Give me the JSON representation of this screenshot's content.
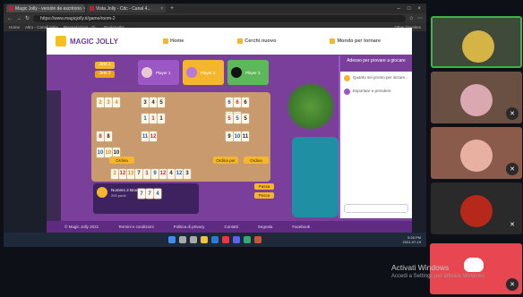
{
  "browser": {
    "tabs": [
      {
        "label": "Magic Jolly - versión de escritorio"
      },
      {
        "label": "Vista Jolly - Cdc - Canal 4..."
      }
    ],
    "new_tab": "+",
    "url": "https://www.magicjolly.it/game/room-2",
    "bookmarks": [
      "Home",
      "Altro - Canali Italia",
      "Presentazioni - Gi...",
      "Bookmarks"
    ],
    "bookmarks_right": "Other favorites"
  },
  "site": {
    "logo": "MAGIC JOLLY",
    "nav": [
      "Home",
      "Cerchi nuovo",
      "Mondo per tornare"
    ],
    "player_tab_1": "Jeni 1",
    "player_tab_2": "Jeni 2",
    "opponents": [
      {
        "name": "Player 1",
        "sub": "200 pts"
      },
      {
        "name": "Player 2",
        "sub": ""
      },
      {
        "name": "Player 3",
        "sub": "200 pts"
      }
    ],
    "buttons": {
      "ordina": "Ordina",
      "ordina2": "Ordina per",
      "b1": "Ordina",
      "b2": "Passa",
      "b3": "Pesca"
    },
    "bottom_player": {
      "name": "Numero 2 Brodi",
      "sub": "200 punti"
    },
    "chat": {
      "title": "Adesso per provare a giocare",
      "messages": [
        "Quanto sei pronto per inizare...",
        "Esportare e prendere"
      ]
    },
    "footer": [
      "© Magic Jolly 2021",
      "Termini e condizioni",
      "Politica di privacy",
      "Contatti",
      "Segnala",
      "Facebook"
    ]
  },
  "board_sets": [
    {
      "tiles": [
        {
          "v": "2",
          "c": "orange"
        },
        {
          "v": "3",
          "c": "orange"
        },
        {
          "v": "4",
          "c": "orange"
        }
      ]
    },
    {
      "tiles": [
        {
          "v": "3",
          "c": "black"
        },
        {
          "v": "4",
          "c": "black"
        },
        {
          "v": "5",
          "c": "black"
        }
      ]
    },
    {
      "tiles": [
        {
          "v": "6",
          "c": "blue"
        },
        {
          "v": "6",
          "c": "red"
        },
        {
          "v": "6",
          "c": "black"
        }
      ]
    },
    {
      "tiles": [
        {
          "v": "5",
          "c": "red"
        },
        {
          "v": "5",
          "c": "red"
        }
      ]
    },
    {
      "tiles": [
        {
          "v": "1",
          "c": "blue"
        },
        {
          "v": "1",
          "c": "red"
        },
        {
          "v": "1",
          "c": "black"
        }
      ]
    },
    {
      "tiles": [
        {
          "v": "5",
          "c": "red"
        },
        {
          "v": "5",
          "c": "blue"
        },
        {
          "v": "5",
          "c": "black"
        }
      ]
    },
    {
      "tiles": [
        {
          "v": "8",
          "c": "red"
        },
        {
          "v": "8",
          "c": "black"
        }
      ]
    },
    {
      "tiles": [
        {
          "v": "11",
          "c": "blue"
        },
        {
          "v": "12",
          "c": "red"
        }
      ]
    },
    {
      "tiles": [
        {
          "v": "9",
          "c": "black"
        },
        {
          "v": "10",
          "c": "blue"
        },
        {
          "v": "11",
          "c": "black"
        }
      ]
    },
    {
      "tiles": [
        {
          "v": "10",
          "c": "blue"
        },
        {
          "v": "10",
          "c": "orange"
        },
        {
          "v": "10",
          "c": "black"
        }
      ]
    }
  ],
  "rack": [
    {
      "v": "3",
      "c": "orange"
    },
    {
      "v": "12",
      "c": "red"
    },
    {
      "v": "13",
      "c": "orange"
    },
    {
      "v": "7",
      "c": "black"
    },
    {
      "v": "1",
      "c": "red"
    },
    {
      "v": "9",
      "c": "blue"
    },
    {
      "v": "12",
      "c": "red"
    },
    {
      "v": "4",
      "c": "black"
    },
    {
      "v": "12",
      "c": "blue"
    },
    {
      "v": "3",
      "c": "black"
    }
  ],
  "bottom_tiles": [
    {
      "v": "7",
      "c": "blue"
    },
    {
      "v": "7",
      "c": "blue"
    },
    {
      "v": "4",
      "c": "blue"
    }
  ],
  "taskbar_clock": {
    "time": "5:28 PM",
    "date": "2021-07-19"
  },
  "windows_activation": {
    "title": "Activati Windows",
    "sub": "Accedi a Settings per attivare Windows"
  }
}
